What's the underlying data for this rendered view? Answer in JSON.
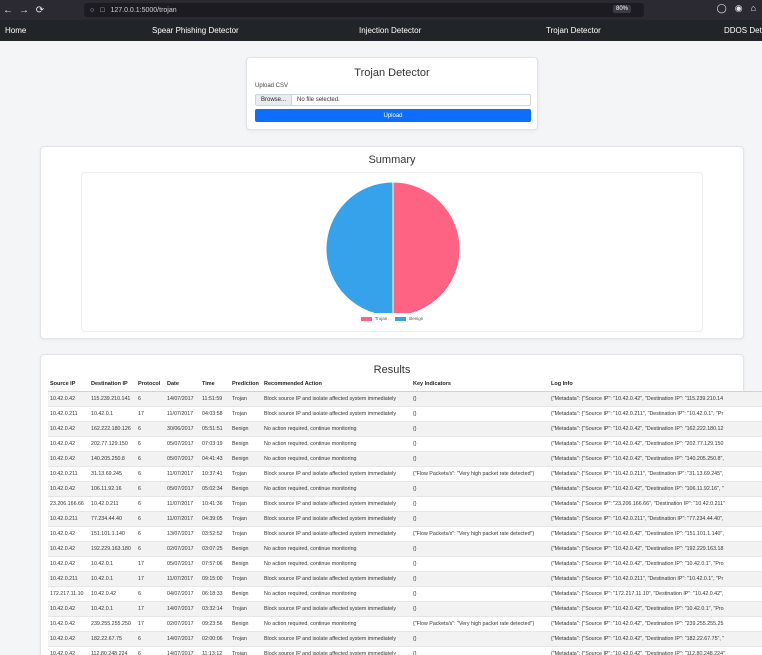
{
  "browser": {
    "url": "127.0.0.1:5000/trojan",
    "zoom": "80%"
  },
  "navbar": {
    "home": "Home",
    "links": [
      "Spear Phishing Detector",
      "Injection Detector",
      "Trojan Detector",
      "DDOS Detec"
    ]
  },
  "upload": {
    "title": "Trojan Detector",
    "label": "Upload CSV",
    "browse": "Browse...",
    "file_status": "No file selected.",
    "button": "Upload"
  },
  "summary": {
    "title": "Summary",
    "colors": {
      "trojan": "#ff6384",
      "benign": "#36a2eb"
    },
    "legend": [
      "Trojan",
      "Benign"
    ]
  },
  "chart_data": {
    "type": "pie",
    "categories": [
      "Trojan",
      "Benign"
    ],
    "values": [
      50,
      50
    ],
    "title": "",
    "legend_position": "bottom"
  },
  "results": {
    "title": "Results",
    "columns": [
      "Source IP",
      "Destination IP",
      "Protocol",
      "Date",
      "Time",
      "Prediction",
      "Recommended Action",
      "Key Indicators",
      "Log Info"
    ],
    "rows": [
      [
        "10.42.0.42",
        "115.239.210.141",
        "6",
        "14/07/2017",
        "11:51:59",
        "Trojan",
        "Block source IP and isolate affected system immediately",
        "{}",
        "{\"Metadata\": {\"Source IP\": \"10.42.0.42\", \"Destination IP\": \"115.239.210.14"
      ],
      [
        "10.42.0.211",
        "10.42.0.1",
        "17",
        "11/07/2017",
        "04:03:58",
        "Trojan",
        "Block source IP and isolate affected system immediately",
        "{}",
        "{\"Metadata\": {\"Source IP\": \"10.42.0.211\", \"Destination IP\": \"10.42.0.1\", \"Pr"
      ],
      [
        "10.42.0.42",
        "162.222.180.126",
        "6",
        "30/06/2017",
        "05:51:51",
        "Benign",
        "No action required, continue monitoring",
        "{}",
        "{\"Metadata\": {\"Source IP\": \"10.42.0.42\", \"Destination IP\": \"162.222.180.12"
      ],
      [
        "10.42.0.42",
        "202.77.129.150",
        "6",
        "05/07/2017",
        "07:03:19",
        "Benign",
        "No action required, continue monitoring",
        "{}",
        "{\"Metadata\": {\"Source IP\": \"10.42.0.42\", \"Destination IP\": \"202.77.129.150"
      ],
      [
        "10.42.0.42",
        "140.205.250.8",
        "6",
        "05/07/2017",
        "04:41:43",
        "Benign",
        "No action required, continue monitoring",
        "{}",
        "{\"Metadata\": {\"Source IP\": \"10.42.0.42\", \"Destination IP\": \"140.205.250.8\","
      ],
      [
        "10.42.0.211",
        "31.13.69.245",
        "6",
        "11/07/2017",
        "10:37:41",
        "Trojan",
        "Block source IP and isolate affected system immediately",
        "{\"Flow Packets/s\": \"Very high packet rate detected\"}",
        "{\"Metadata\": {\"Source IP\": \"10.42.0.211\", \"Destination IP\": \"31.13.69.245\","
      ],
      [
        "10.42.0.42",
        "106.11.92.16",
        "6",
        "05/07/2017",
        "05:02:34",
        "Benign",
        "No action required, continue monitoring",
        "{}",
        "{\"Metadata\": {\"Source IP\": \"10.42.0.42\", \"Destination IP\": \"106.11.92.16\", \""
      ],
      [
        "23.206.166.66",
        "10.42.0.211",
        "6",
        "11/07/2017",
        "10:41:36",
        "Trojan",
        "Block source IP and isolate affected system immediately",
        "{}",
        "{\"Metadata\": {\"Source IP\": \"23.206.166.66\", \"Destination IP\": \"10.42.0.211\""
      ],
      [
        "10.42.0.211",
        "77.234.44.40",
        "6",
        "11/07/2017",
        "04:39:05",
        "Trojan",
        "Block source IP and isolate affected system immediately",
        "{}",
        "{\"Metadata\": {\"Source IP\": \"10.42.0.211\", \"Destination IP\": \"77.234.44.40\","
      ],
      [
        "10.42.0.42",
        "151.101.1.140",
        "6",
        "13/07/2017",
        "03:52:52",
        "Trojan",
        "Block source IP and isolate affected system immediately",
        "{\"Flow Packets/s\": \"Very high packet rate detected\"}",
        "{\"Metadata\": {\"Source IP\": \"10.42.0.42\", \"Destination IP\": \"151.101.1.140\","
      ],
      [
        "10.42.0.42",
        "192.229.163.180",
        "6",
        "02/07/2017",
        "03:07:25",
        "Benign",
        "No action required, continue monitoring",
        "{}",
        "{\"Metadata\": {\"Source IP\": \"10.42.0.42\", \"Destination IP\": \"192.229.163.18"
      ],
      [
        "10.42.0.42",
        "10.42.0.1",
        "17",
        "05/07/2017",
        "07:57:06",
        "Benign",
        "No action required, continue monitoring",
        "{}",
        "{\"Metadata\": {\"Source IP\": \"10.42.0.42\", \"Destination IP\": \"10.42.0.1\", \"Pro"
      ],
      [
        "10.42.0.211",
        "10.42.0.1",
        "17",
        "11/07/2017",
        "09:15:00",
        "Trojan",
        "Block source IP and isolate affected system immediately",
        "{}",
        "{\"Metadata\": {\"Source IP\": \"10.42.0.211\", \"Destination IP\": \"10.42.0.1\", \"Pr"
      ],
      [
        "172.217.11.10",
        "10.42.0.42",
        "6",
        "04/07/2017",
        "06:18:33",
        "Benign",
        "No action required, continue monitoring",
        "{}",
        "{\"Metadata\": {\"Source IP\": \"172.217.11.10\", \"Destination IP\": \"10.42.0.42\","
      ],
      [
        "10.42.0.42",
        "10.42.0.1",
        "17",
        "14/07/2017",
        "03:32:14",
        "Trojan",
        "Block source IP and isolate affected system immediately",
        "{}",
        "{\"Metadata\": {\"Source IP\": \"10.42.0.42\", \"Destination IP\": \"10.42.0.1\", \"Pro"
      ],
      [
        "10.42.0.42",
        "239.255.255.250",
        "17",
        "02/07/2017",
        "09:23:56",
        "Benign",
        "No action required, continue monitoring",
        "{\"Flow Packets/s\": \"Very high packet rate detected\"}",
        "{\"Metadata\": {\"Source IP\": \"10.42.0.42\", \"Destination IP\": \"239.255.255.25"
      ],
      [
        "10.42.0.42",
        "182.22.67.75",
        "6",
        "14/07/2017",
        "02:00:06",
        "Trojan",
        "Block source IP and isolate affected system immediately",
        "{}",
        "{\"Metadata\": {\"Source IP\": \"10.42.0.42\", \"Destination IP\": \"182.22.67.75\", \""
      ],
      [
        "10.42.0.42",
        "112.80.248.224",
        "6",
        "14/07/2017",
        "11:13:12",
        "Trojan",
        "Block source IP and isolate affected system immediately",
        "{}",
        "{\"Metadata\": {\"Source IP\": \"10.42.0.42\", \"Destination IP\": \"112.80.248.224\""
      ]
    ]
  }
}
